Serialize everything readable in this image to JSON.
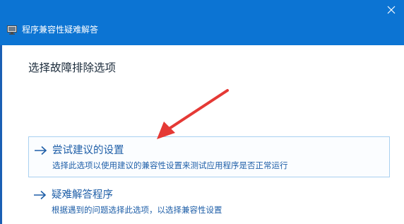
{
  "window": {
    "title": "程序兼容性疑难解答",
    "titlebar_color": "#0c74d3"
  },
  "main": {
    "heading": "选择故障排除选项",
    "options": [
      {
        "title": "尝试建议的设置",
        "description": "选择此选项以使用建议的兼容性设置来测试应用程序是否正常运行",
        "selected": true
      },
      {
        "title": "疑难解答程序",
        "description": "根据遇到的问题选择此选项，以选择兼容性设置",
        "selected": false
      }
    ]
  },
  "icons": {
    "close": "close-icon",
    "app": "troubleshooter-app-icon",
    "option_arrow": "arrow-right-icon",
    "annotation": "red-annotation-arrow"
  },
  "colors": {
    "accent": "#1f5fa8",
    "selection_border": "#a9d0f0",
    "annotation_red": "#e53935"
  }
}
